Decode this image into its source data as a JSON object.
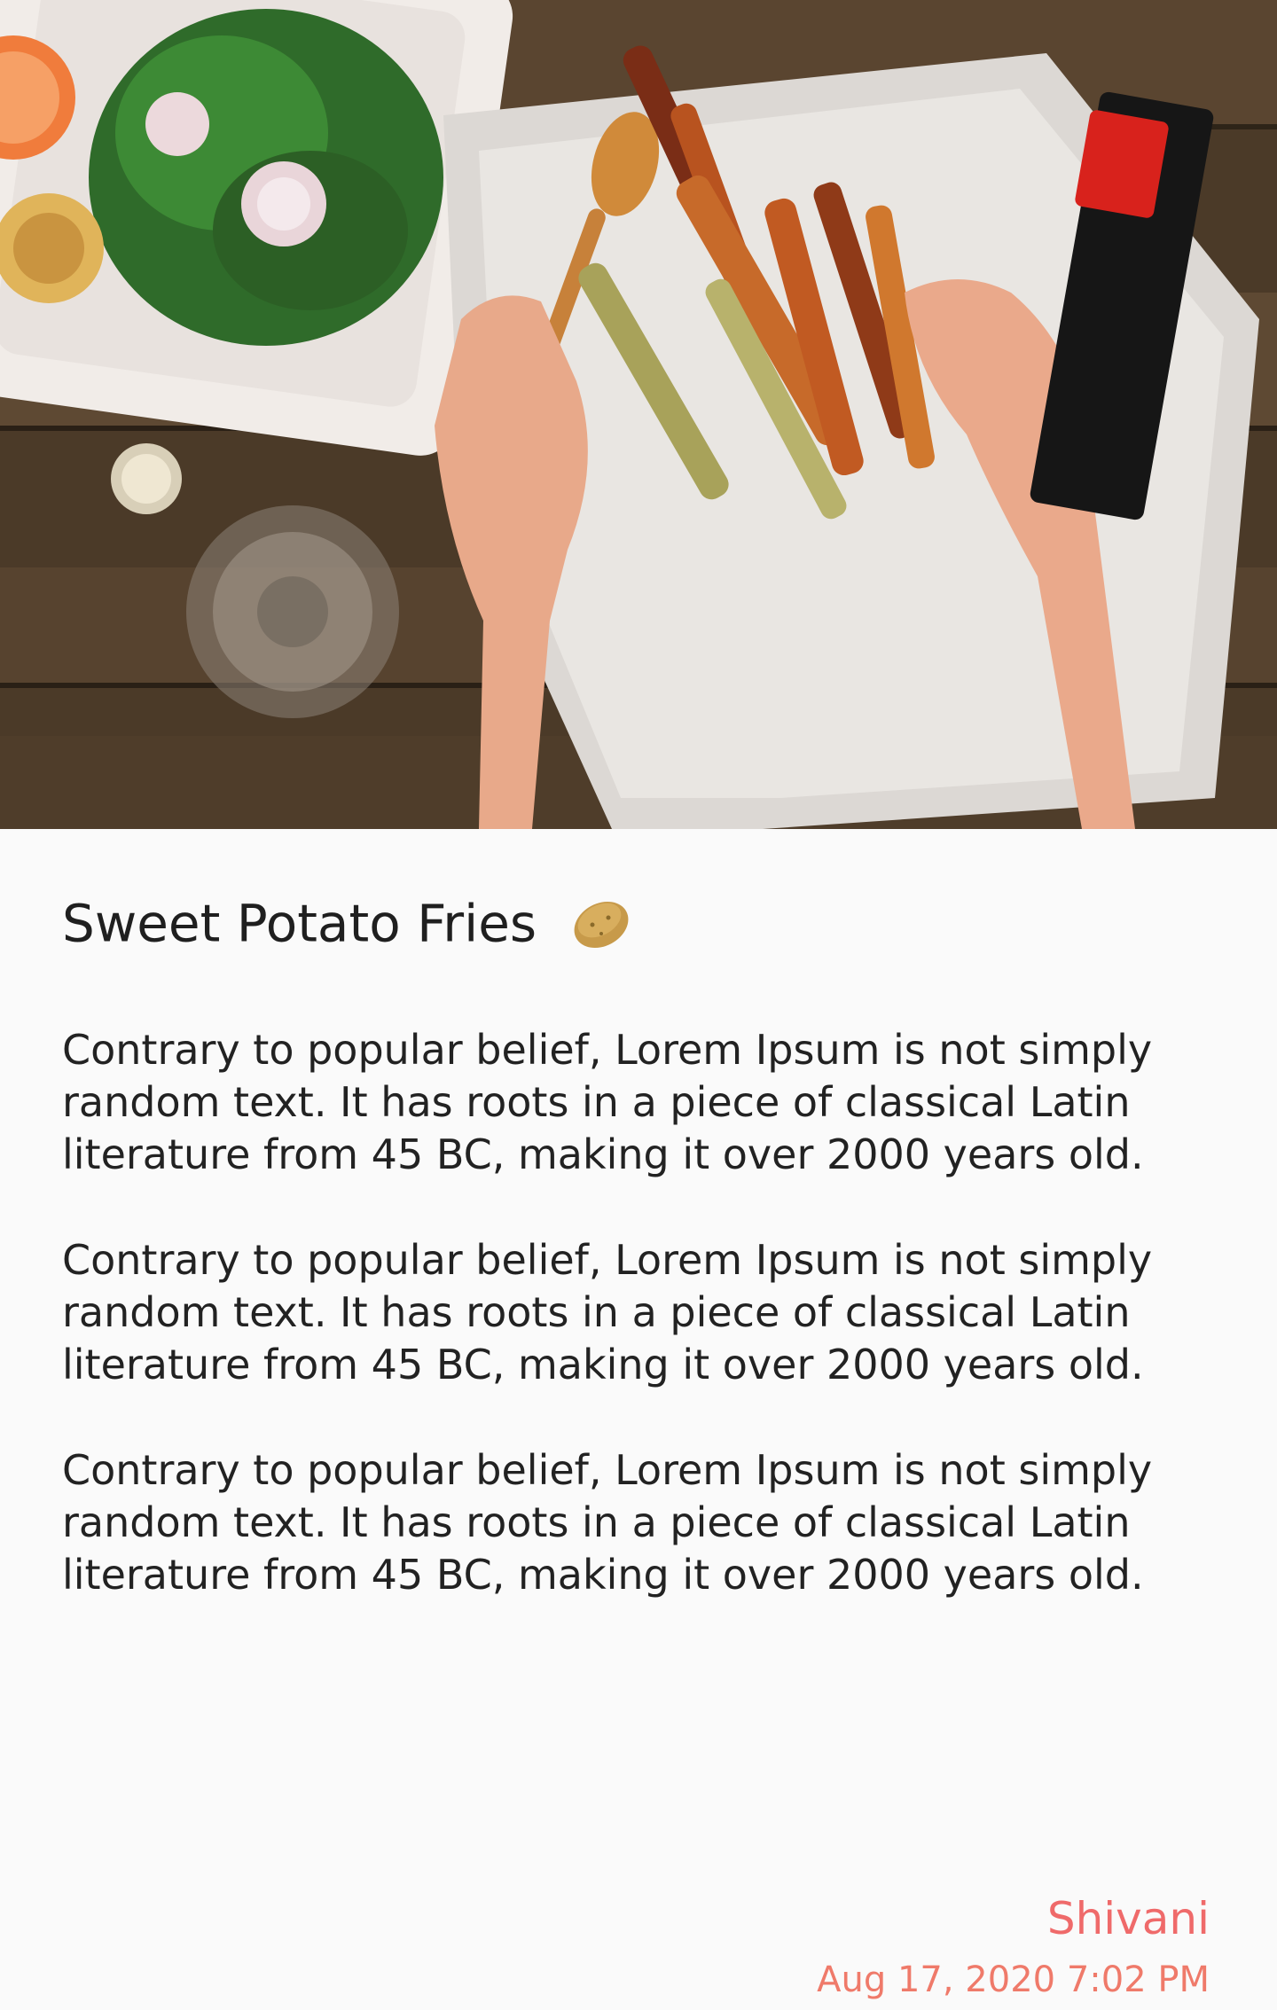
{
  "article": {
    "title": "Sweet Potato Fries",
    "title_icon": "potato-icon",
    "paragraphs": [
      "Contrary to popular belief, Lorem Ipsum is not simply random text. It has roots in a piece of classical Latin literature from 45 BC, making it over 2000 years old.",
      "Contrary to popular belief, Lorem Ipsum is not simply random text. It has roots in a piece of classical Latin literature from 45 BC, making it over 2000 years old.",
      "Contrary to popular belief, Lorem Ipsum is not simply random text. It has roots in a piece of classical Latin literature from 45 BC, making it over 2000 years old."
    ],
    "author": "Shivani",
    "date": "Aug 17, 2020 7:02 PM"
  },
  "colors": {
    "author": "#ef6a6a",
    "date": "#ef7a6a",
    "background": "#fafafa",
    "text": "#222222"
  }
}
